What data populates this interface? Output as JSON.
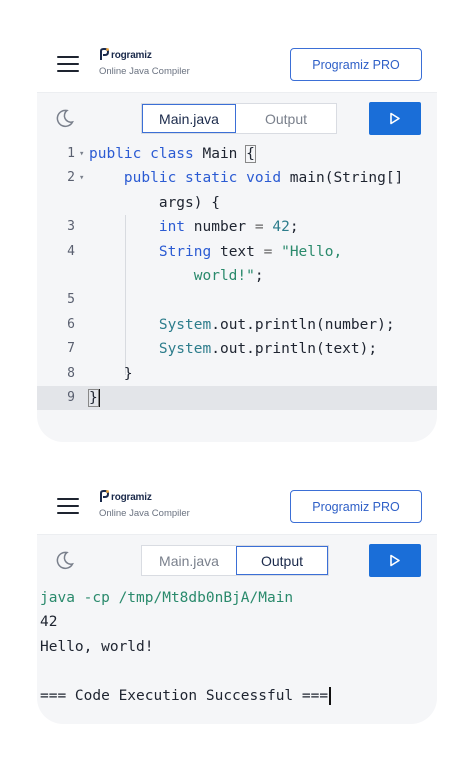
{
  "header": {
    "brand_name": "rogramiz",
    "brand_subtitle": "Online Java Compiler",
    "pro_button": "Programiz PRO"
  },
  "tabs": {
    "main": "Main.java",
    "output": "Output"
  },
  "editor": {
    "line_numbers": [
      "1",
      "2",
      "3",
      "4",
      "5",
      "6",
      "7",
      "8",
      "9"
    ],
    "lines": {
      "l1_kw": "public class",
      "l1_rest": " Main ",
      "l1_brace": "{",
      "l2_kw": "public static void",
      "l2_rest": " main(String[]",
      "l2_cont": "args) {",
      "l3_kw": "int",
      "l3_rest": " number ",
      "l3_eq": "=",
      "l3_num": "42",
      "l3_end": ";",
      "l4_kw": "String",
      "l4_rest": " text ",
      "l4_eq": "=",
      "l4_str": "\"Hello,",
      "l4_cont_str": "world!\"",
      "l4_end": ";",
      "l6_cls": "System",
      "l6_rest": ".out.println(number);",
      "l7_cls": "System",
      "l7_rest": ".out.println(text);",
      "l8": "}",
      "l9": "}"
    }
  },
  "output": {
    "command": "java -cp /tmp/Mt8db0nBjA/Main",
    "line1": "42",
    "line2": "Hello, world!",
    "line3": "",
    "line4": "=== Code Execution Successful ==="
  },
  "colors": {
    "accent": "#1a6ed8",
    "keyword": "#2b5bd3",
    "string": "#2a8a6c"
  },
  "icons": [
    "hamburger-icon",
    "moon-icon",
    "play-icon",
    "fold-arrow-icon"
  ]
}
